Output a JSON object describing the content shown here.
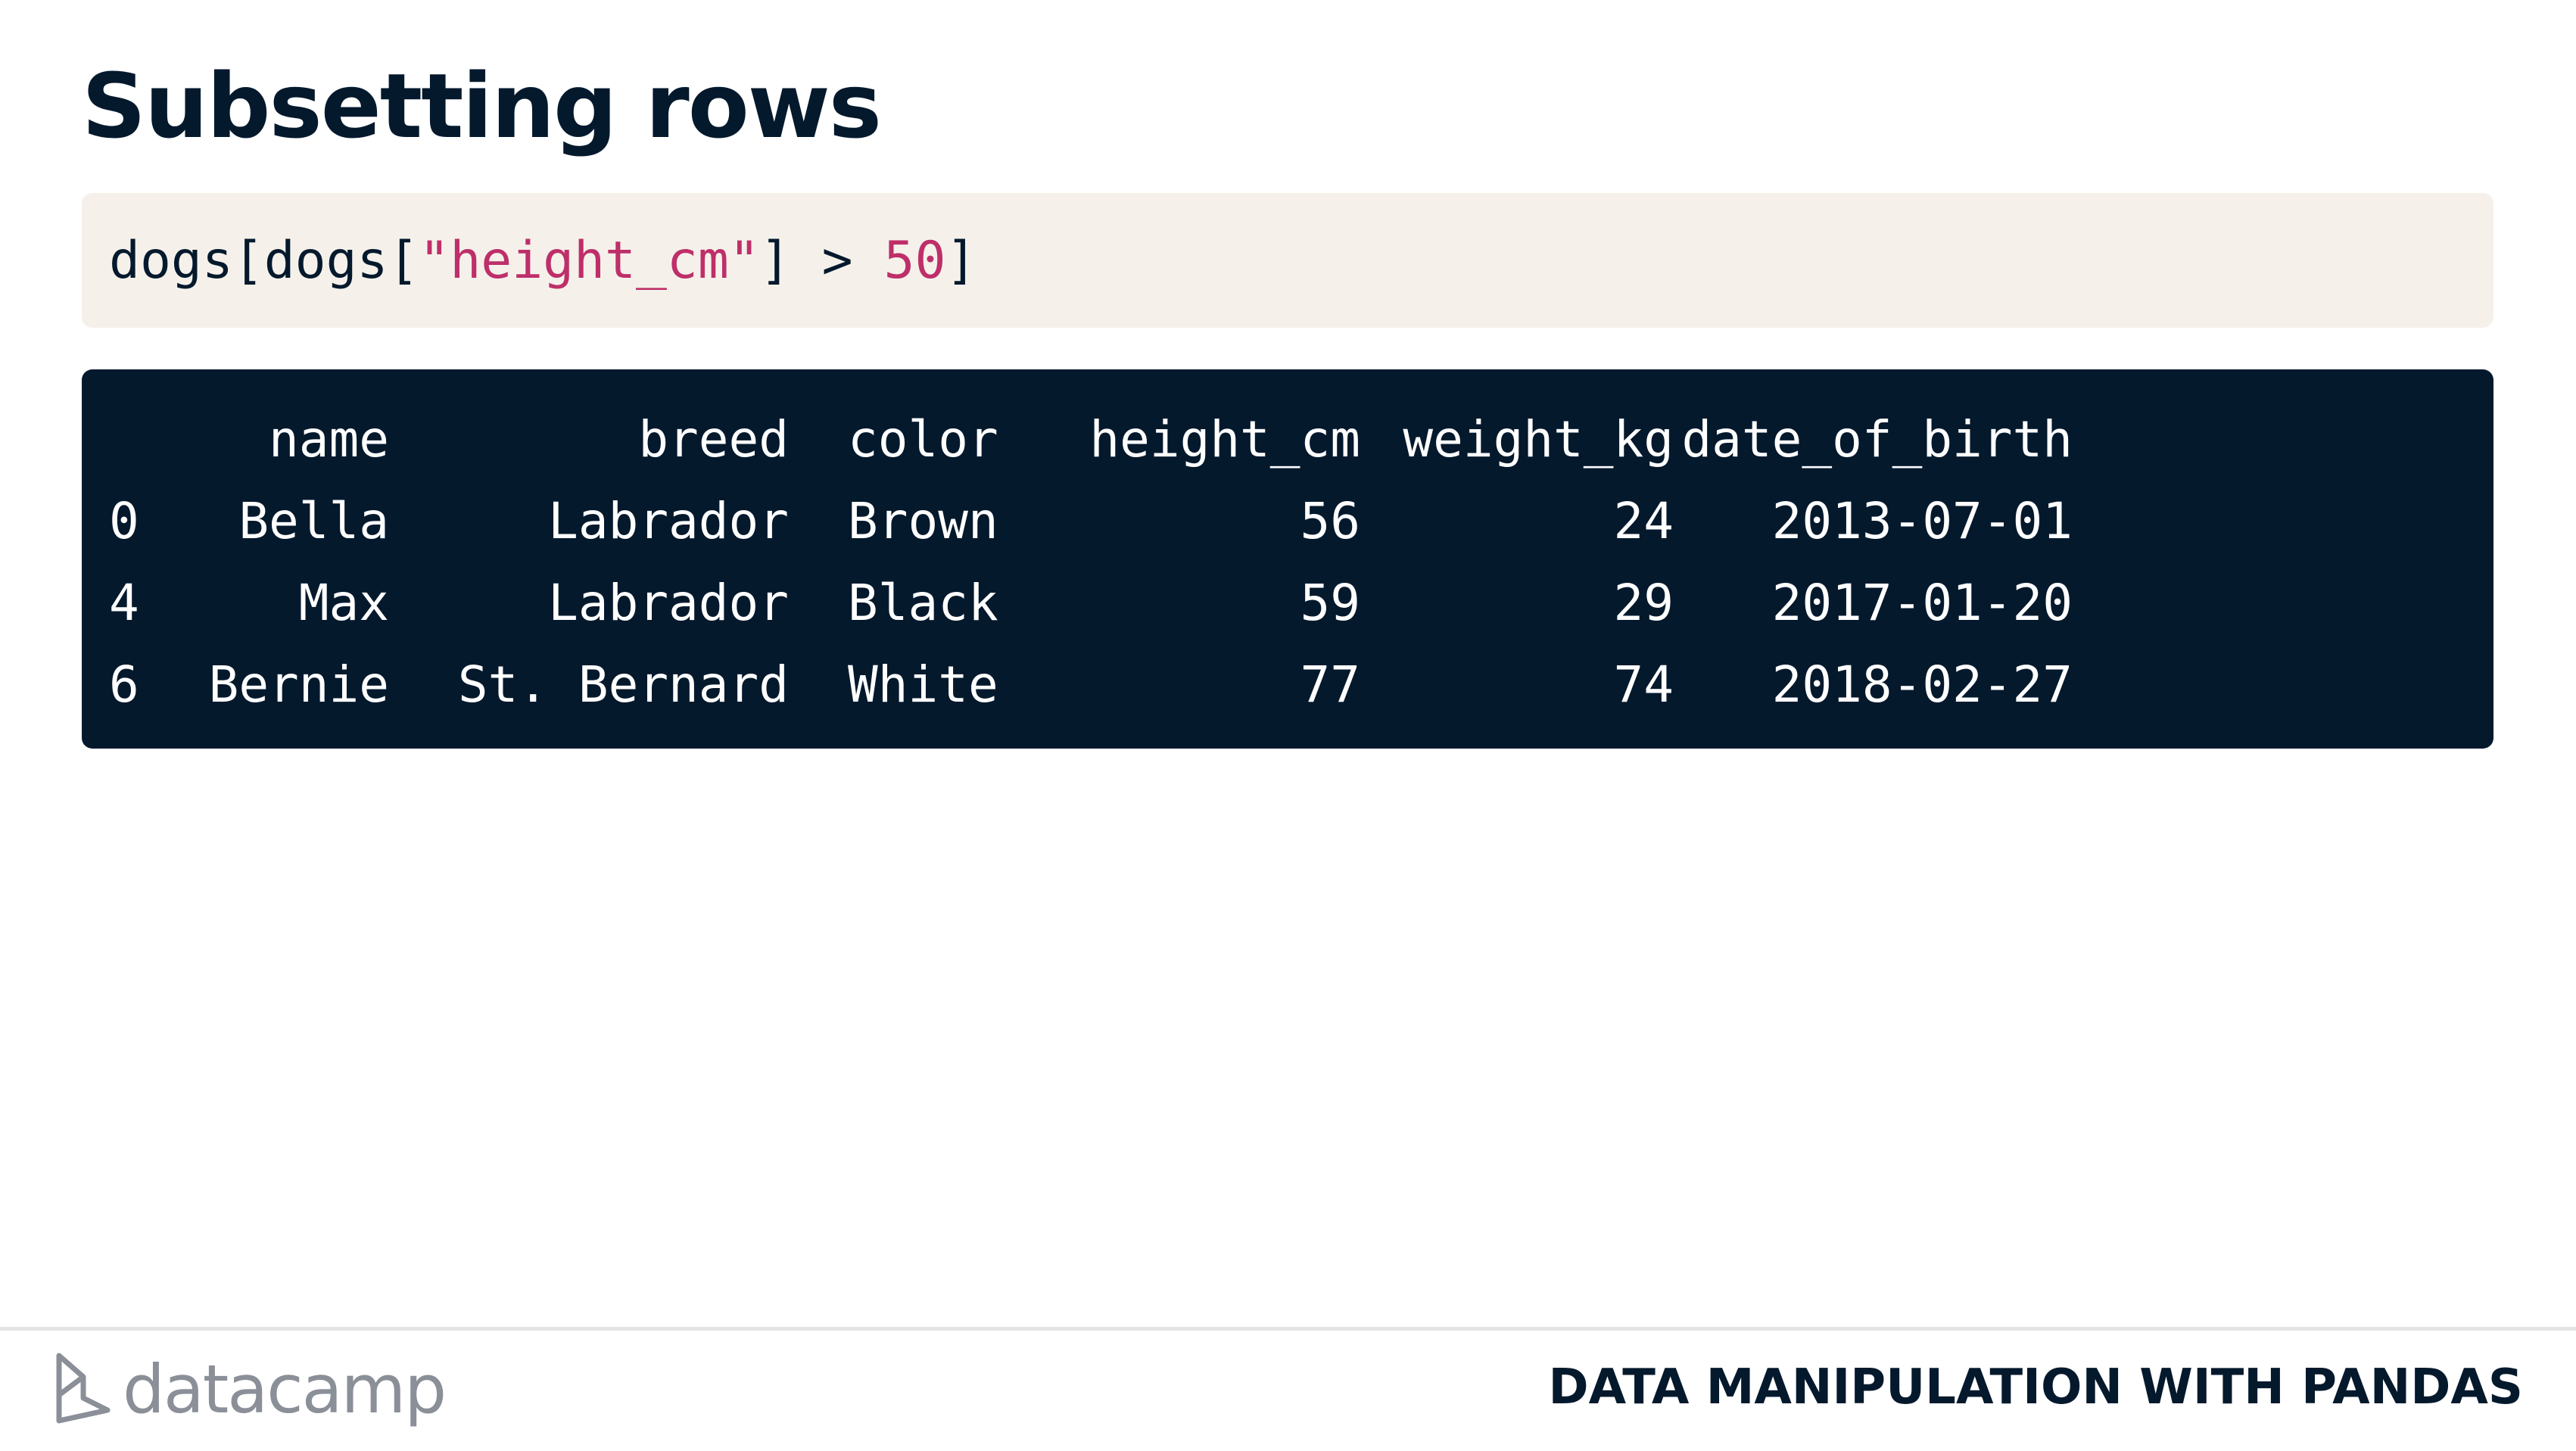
{
  "slide": {
    "title": "Subsetting rows",
    "course": "DATA MANIPULATION WITH PANDAS",
    "logo_text": "datacamp"
  },
  "code": {
    "prefix": "dogs[dogs[",
    "string": "\"height_cm\"",
    "middle": "] > ",
    "number": "50",
    "suffix": "]"
  },
  "output": {
    "headers": [
      "",
      "name",
      "breed",
      "color",
      "height_cm",
      "weight_kg",
      "date_of_birth"
    ],
    "rows": [
      [
        "0",
        "Bella",
        "Labrador",
        "Brown",
        "56",
        "24",
        "2013-07-01"
      ],
      [
        "4",
        "Max",
        "Labrador",
        "Black",
        "59",
        "29",
        "2017-01-20"
      ],
      [
        "6",
        "Bernie",
        "St. Bernard",
        "White",
        "77",
        "74",
        "2018-02-27"
      ]
    ]
  },
  "colors": {
    "title": "#05192d",
    "code_bg": "#f5f1ea",
    "code_accent": "#be2f6a",
    "output_bg": "#05192d",
    "output_text": "#ffffff"
  },
  "icons": {
    "logo": "datacamp-logo-icon"
  }
}
